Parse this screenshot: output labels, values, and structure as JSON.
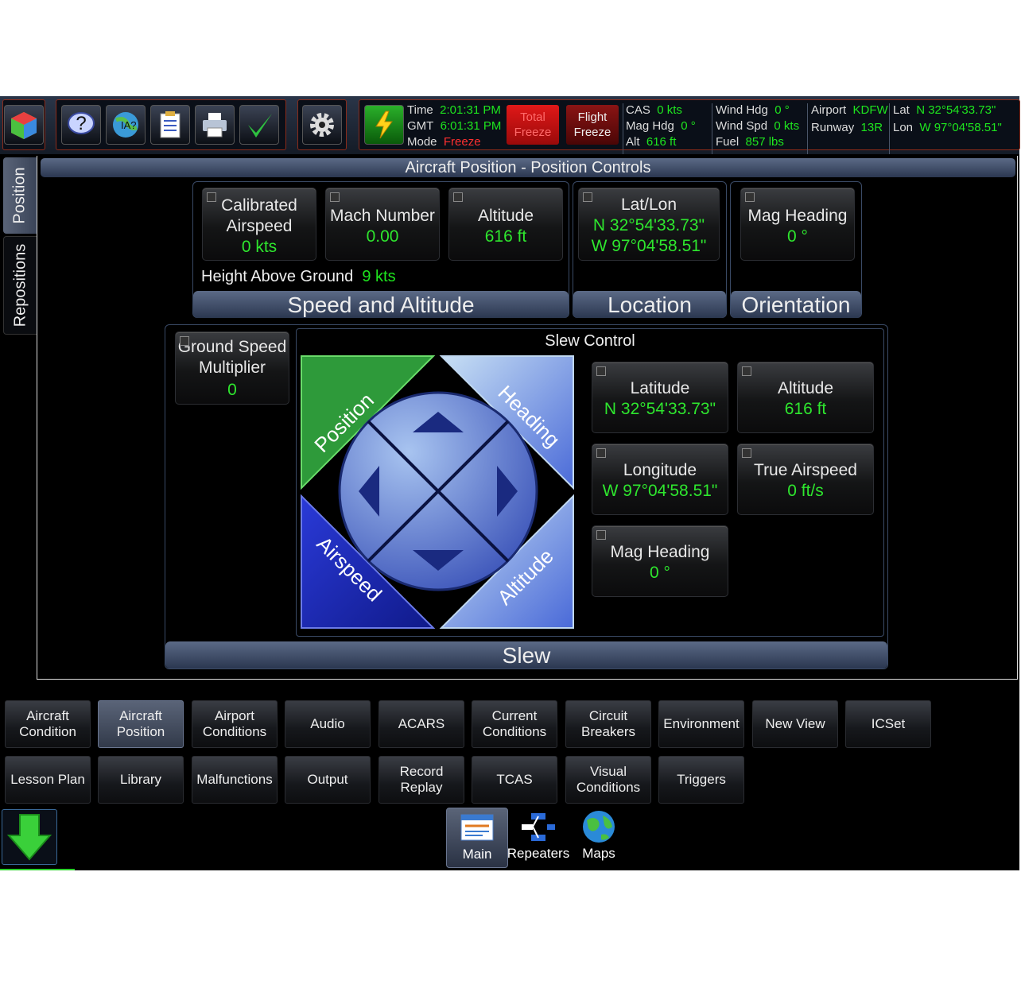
{
  "toolbar": {
    "status": {
      "time_label": "Time",
      "time_value": "2:01:31 PM",
      "gmt_label": "GMT",
      "gmt_value": "6:01:31 PM",
      "mode_label": "Mode",
      "mode_value": "Freeze"
    },
    "total_freeze": "Total Freeze",
    "flight_freeze": "Flight Freeze",
    "cas_label": "CAS",
    "cas_value": "0 kts",
    "maghdg_label": "Mag Hdg",
    "maghdg_value": "0 °",
    "alt_label": "Alt",
    "alt_value": "616 ft",
    "windhdg_label": "Wind Hdg",
    "windhdg_value": "0 °",
    "windspd_label": "Wind Spd",
    "windspd_value": "0 kts",
    "fuel_label": "Fuel",
    "fuel_value": "857 lbs",
    "airport_label": "Airport",
    "airport_value": "KDFW",
    "runway_label": "Runway",
    "runway_value": "13R",
    "lat_label": "Lat",
    "lat_value": "N 32°54'33.73\"",
    "lon_label": "Lon",
    "lon_value": "W 97°04'58.51\""
  },
  "side_tabs": {
    "position": "Position",
    "repositions": "Repositions"
  },
  "page_title": "Aircraft Position - Position Controls",
  "speed_alt": {
    "title": "Speed and Altitude",
    "cas_title": "Calibrated Airspeed",
    "cas_value": "0 kts",
    "mach_title": "Mach Number",
    "mach_value": "0.00",
    "alt_title": "Altitude",
    "alt_value": "616 ft",
    "hag_label": "Height Above Ground",
    "hag_value": "9 kts"
  },
  "location": {
    "title": "Location",
    "tile_title": "Lat/Lon",
    "lat": "N 32°54'33.73\"",
    "lon": "W 97°04'58.51\""
  },
  "orientation": {
    "title": "Orientation",
    "tile_title": "Mag Heading",
    "value": "0 °"
  },
  "slew": {
    "title": "Slew",
    "control_title": "Slew Control",
    "gs_title1": "Ground Speed",
    "gs_title2": "Multiplier",
    "gs_value": "0",
    "pad": {
      "position": "Position",
      "heading": "Heading",
      "airspeed": "Airspeed",
      "altitude": "Altitude"
    },
    "lat_title": "Latitude",
    "lat_value": "N 32°54'33.73\"",
    "alt_title": "Altitude",
    "alt_value": "616 ft",
    "lon_title": "Longitude",
    "lon_value": "W 97°04'58.51\"",
    "tas_title": "True Airspeed",
    "tas_value": "0 ft/s",
    "mag_title": "Mag Heading",
    "mag_value": "0 °"
  },
  "nav_row1": [
    {
      "l1": "Aircraft",
      "l2": "Condition"
    },
    {
      "l1": "Aircraft",
      "l2": "Position"
    },
    {
      "l1": "Airport",
      "l2": "Conditions"
    },
    {
      "l1": "Audio",
      "l2": ""
    },
    {
      "l1": "ACARS",
      "l2": ""
    },
    {
      "l1": "Current",
      "l2": "Conditions"
    },
    {
      "l1": "Circuit",
      "l2": "Breakers"
    },
    {
      "l1": "Environment",
      "l2": ""
    },
    {
      "l1": "New View",
      "l2": ""
    },
    {
      "l1": "ICSet",
      "l2": ""
    }
  ],
  "nav_row2": [
    {
      "l1": "Lesson Plan",
      "l2": ""
    },
    {
      "l1": "Library",
      "l2": ""
    },
    {
      "l1": "Malfunctions",
      "l2": ""
    },
    {
      "l1": "Output",
      "l2": ""
    },
    {
      "l1": "Record",
      "l2": "Replay"
    },
    {
      "l1": "TCAS",
      "l2": ""
    },
    {
      "l1": "Visual",
      "l2": "Conditions"
    },
    {
      "l1": "Triggers",
      "l2": ""
    }
  ],
  "bottom_tabs": {
    "main": "Main",
    "repeaters": "Repeaters",
    "maps": "Maps"
  },
  "colors": {
    "value_green": "#2ee62e",
    "freeze_red": "#ff3030",
    "selected": "#5a6478"
  }
}
